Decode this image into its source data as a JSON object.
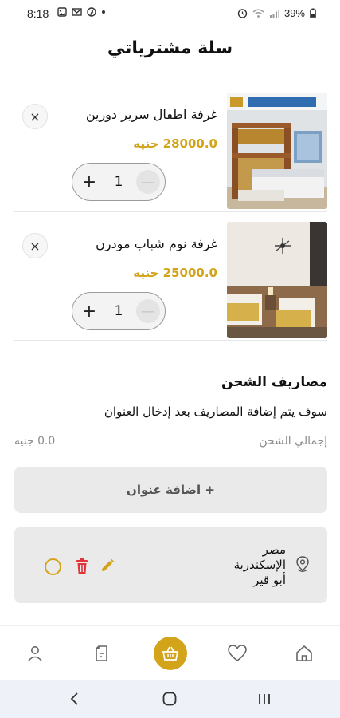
{
  "status_bar": {
    "time": "8:18",
    "battery": "39%"
  },
  "header": {
    "title": "سلة مشترياتي"
  },
  "cart": {
    "items": [
      {
        "name": "غرفة اطفال سرير دورين",
        "price": "28000.0 جنيه",
        "quantity": "1"
      },
      {
        "name": "غرفة نوم شباب مودرن",
        "price": "25000.0 جنيه",
        "quantity": "1"
      }
    ],
    "qty_plus": "+",
    "qty_minus": "—",
    "remove": "×"
  },
  "shipping": {
    "title": "مصاريف الشحن",
    "note": "سوف يتم إضافة المصاريف بعد إدخال العنوان",
    "total_label": "إجمالي الشحن",
    "total_value": "0.0 جنيه",
    "add_address_label": "+ اضافة عنوان"
  },
  "address": {
    "line1": "مصر",
    "line2": "الإسكندرية",
    "line3": "أبو قير"
  },
  "colors": {
    "accent": "#d3a31a",
    "delete": "#e0333a"
  },
  "bottom_nav": {
    "items": [
      "home-icon",
      "heart-icon",
      "basket-icon",
      "orders-icon",
      "user-icon"
    ]
  }
}
